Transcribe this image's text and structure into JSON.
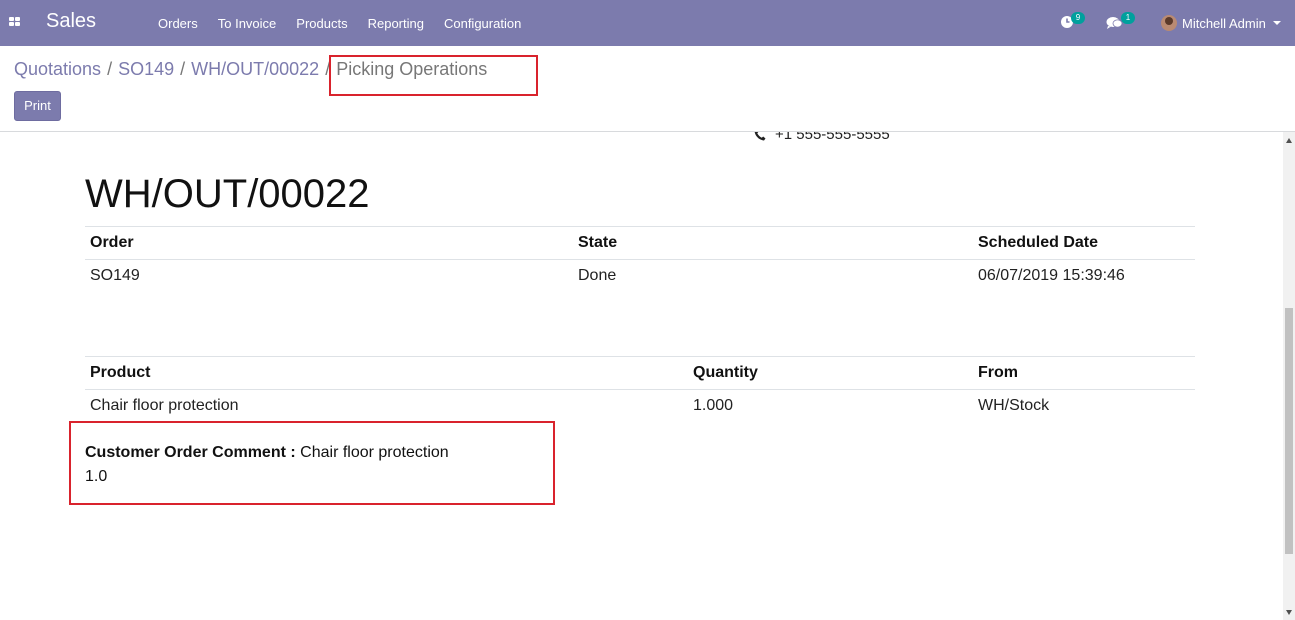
{
  "navbar": {
    "app_name": "Sales",
    "menu": [
      "Orders",
      "To Invoice",
      "Products",
      "Reporting",
      "Configuration"
    ],
    "activity_count": "9",
    "message_count": "1",
    "user_name": "Mitchell Admin"
  },
  "breadcrumb": {
    "items": [
      "Quotations",
      "SO149",
      "WH/OUT/00022"
    ],
    "separator": "/",
    "active": "Picking Operations"
  },
  "actions": {
    "print_label": "Print"
  },
  "report": {
    "phone": "+1 555-555-5555",
    "title": "WH/OUT/00022",
    "info_table": {
      "headers": [
        "Order",
        "State",
        "Scheduled Date"
      ],
      "row": [
        "SO149",
        "Done",
        "06/07/2019 15:39:46"
      ]
    },
    "lines_table": {
      "headers": [
        "Product",
        "Quantity",
        "From"
      ],
      "row": [
        "Chair floor protection",
        "1.000",
        "WH/Stock"
      ]
    },
    "comment": {
      "label": "Customer Order Comment :",
      "value": "Chair floor protection",
      "value2": "1.0"
    }
  },
  "colors": {
    "navbar": "#7c7bad",
    "badge": "#00a09d",
    "highlight": "#d9232d"
  }
}
